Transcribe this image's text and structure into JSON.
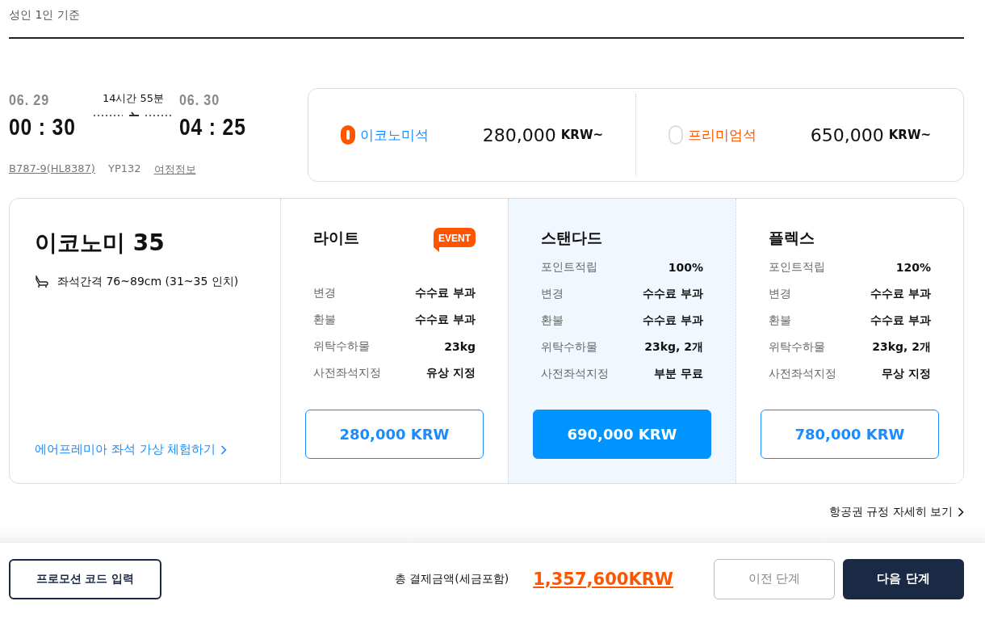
{
  "header": {
    "note": "성인 1인 기준"
  },
  "flight": {
    "depart_date": "06. 29",
    "depart_time": "00 : 30",
    "duration": "14시간 55분",
    "arrive_date": "06. 30",
    "arrive_time": "04 : 25",
    "aircraft": "B787-9(HL8387)",
    "flight_no": "YP132",
    "itinerary_link": "여정정보"
  },
  "cabins": [
    {
      "name": "이코노미석",
      "price": "280,000",
      "currency": "KRW~",
      "selected": true
    },
    {
      "name": "프리미엄석",
      "price": "650,000",
      "currency": "KRW~",
      "selected": false
    }
  ],
  "cabin_detail": {
    "title": "이코노미 35",
    "seat_pitch": "좌석간격 76~89cm (31~35 인치)",
    "experience_link": "에어프레미아 좌석 가상 체험하기"
  },
  "fares": [
    {
      "name": "라이트",
      "badge": "EVENT",
      "selected": false,
      "rows": [
        {
          "label": "변경",
          "value": "수수료 부과"
        },
        {
          "label": "환불",
          "value": "수수료 부과"
        },
        {
          "label": "위탁수하물",
          "value": "23kg"
        },
        {
          "label": "사전좌석지정",
          "value": "유상 지정"
        }
      ],
      "price": "280,000 KRW"
    },
    {
      "name": "스탠다드",
      "selected": true,
      "rows": [
        {
          "label": "포인트적립",
          "value": "100%"
        },
        {
          "label": "변경",
          "value": "수수료 부과"
        },
        {
          "label": "환불",
          "value": "수수료 부과"
        },
        {
          "label": "위탁수하물",
          "value": "23kg, 2개"
        },
        {
          "label": "사전좌석지정",
          "value": "부분 무료"
        }
      ],
      "price": "690,000 KRW"
    },
    {
      "name": "플렉스",
      "selected": false,
      "rows": [
        {
          "label": "포인트적립",
          "value": "120%"
        },
        {
          "label": "변경",
          "value": "수수료 부과"
        },
        {
          "label": "환불",
          "value": "수수료 부과"
        },
        {
          "label": "위탁수하물",
          "value": "23kg, 2개"
        },
        {
          "label": "사전좌석지정",
          "value": "무상 지정"
        }
      ],
      "price": "780,000 KRW"
    }
  ],
  "rules_link": "항공권 규정 자세히 보기",
  "footer": {
    "promo_button": "프로모션 코드 입력",
    "total_label": "총 결제금액(세금포함)",
    "total": "1,357,600KRW",
    "prev_button": "이전 단계",
    "next_button": "다음 단계"
  }
}
